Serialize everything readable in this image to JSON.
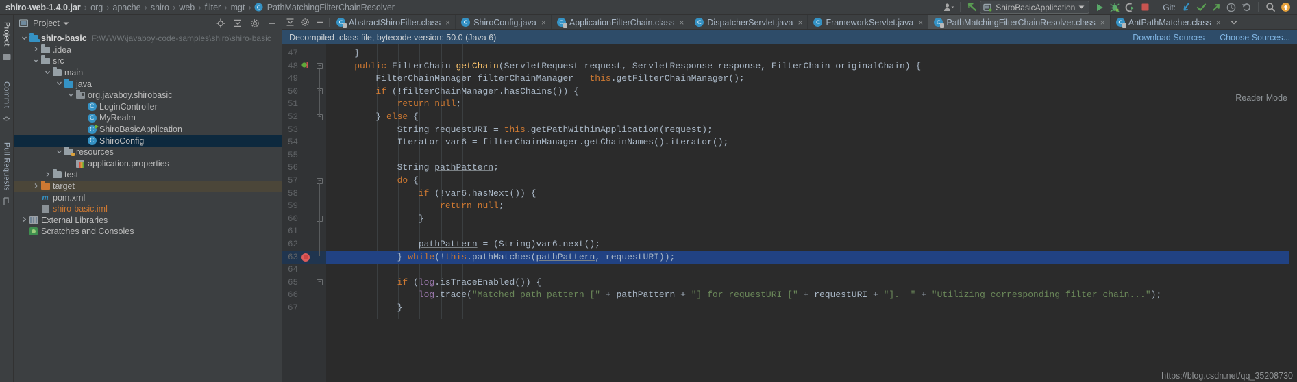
{
  "topbar": {
    "breadcrumbs": [
      "shiro-web-1.4.0.jar",
      "org",
      "apache",
      "shiro",
      "web",
      "filter",
      "mgt",
      "PathMatchingFilterChainResolver"
    ],
    "run_config": "ShiroBasicApplication",
    "git_label": "Git:",
    "icons": [
      "settings-sync-icon",
      "notifications-icon",
      "avatar-icon",
      "updates-icon",
      "run-icon",
      "debug-icon",
      "run-coverage-icon",
      "stop-icon",
      "git-update-icon",
      "git-commit-icon",
      "git-push-icon",
      "git-history-icon",
      "git-rollback-icon",
      "search-everywhere-icon",
      "user-badge-icon"
    ]
  },
  "left_strip": {
    "tabs": [
      "Project",
      "Commit",
      "Pull Requests"
    ]
  },
  "project_panel": {
    "title": "Project",
    "header_icons": [
      "locate-icon",
      "collapse-all-icon",
      "settings-icon",
      "hide-icon"
    ],
    "tree": [
      {
        "label": "shiro-basic",
        "path": "F:\\WWW\\javaboy-code-samples\\shiro\\shiro-basic",
        "indent": 0,
        "arrow": "expanded",
        "icon": "module-folder-icon",
        "state": "bold"
      },
      {
        "label": ".idea",
        "path": "",
        "indent": 1,
        "arrow": "collapsed",
        "icon": "folder-icon",
        "state": ""
      },
      {
        "label": "src",
        "path": "",
        "indent": 1,
        "arrow": "expanded",
        "icon": "folder-icon",
        "state": ""
      },
      {
        "label": "main",
        "path": "",
        "indent": 2,
        "arrow": "expanded",
        "icon": "folder-icon",
        "state": ""
      },
      {
        "label": "java",
        "path": "",
        "indent": 3,
        "arrow": "expanded",
        "icon": "source-folder-icon",
        "state": ""
      },
      {
        "label": "org.javaboy.shirobasic",
        "path": "",
        "indent": 4,
        "arrow": "expanded",
        "icon": "package-icon",
        "state": ""
      },
      {
        "label": "LoginController",
        "path": "",
        "indent": 5,
        "arrow": "none",
        "icon": "class-icon",
        "state": ""
      },
      {
        "label": "MyRealm",
        "path": "",
        "indent": 5,
        "arrow": "none",
        "icon": "class-icon",
        "state": ""
      },
      {
        "label": "ShiroBasicApplication",
        "path": "",
        "indent": 5,
        "arrow": "none",
        "icon": "runnable-class-icon",
        "state": ""
      },
      {
        "label": "ShiroConfig",
        "path": "",
        "indent": 5,
        "arrow": "none",
        "icon": "class-icon",
        "state": "selected"
      },
      {
        "label": "resources",
        "path": "",
        "indent": 3,
        "arrow": "expanded",
        "icon": "resource-folder-icon",
        "state": ""
      },
      {
        "label": "application.properties",
        "path": "",
        "indent": 4,
        "arrow": "none",
        "icon": "properties-icon",
        "state": ""
      },
      {
        "label": "test",
        "path": "",
        "indent": 2,
        "arrow": "collapsed",
        "icon": "folder-icon",
        "state": ""
      },
      {
        "label": "target",
        "path": "",
        "indent": 1,
        "arrow": "collapsed",
        "icon": "excluded-folder-icon",
        "state": "target"
      },
      {
        "label": "pom.xml",
        "path": "",
        "indent": 1,
        "arrow": "none",
        "icon": "maven-icon",
        "state": ""
      },
      {
        "label": "shiro-basic.iml",
        "path": "",
        "indent": 1,
        "arrow": "none",
        "icon": "iml-icon",
        "state": "orange"
      },
      {
        "label": "External Libraries",
        "path": "",
        "indent": 0,
        "arrow": "collapsed",
        "icon": "library-icon",
        "state": ""
      },
      {
        "label": "Scratches and Consoles",
        "path": "",
        "indent": 0,
        "arrow": "none",
        "icon": "scratches-icon",
        "state": ""
      }
    ]
  },
  "editor": {
    "tab_tools": [
      "collapse-icon",
      "settings-icon",
      "hide-icon"
    ],
    "tabs": [
      {
        "label": "AbstractShiroFilter.class",
        "icon": "class-file-icon",
        "active": false
      },
      {
        "label": "ShiroConfig.java",
        "icon": "java-file-icon",
        "active": false
      },
      {
        "label": "ApplicationFilterChain.class",
        "icon": "class-file-icon",
        "active": false
      },
      {
        "label": "DispatcherServlet.java",
        "icon": "java-file-icon",
        "active": false
      },
      {
        "label": "FrameworkServlet.java",
        "icon": "java-file-icon",
        "active": false
      },
      {
        "label": "PathMatchingFilterChainResolver.class",
        "icon": "class-file-icon",
        "active": true
      },
      {
        "label": "AntPathMatcher.class",
        "icon": "class-file-icon",
        "active": false
      }
    ],
    "tab_close_label": "×",
    "tab_overflow_icon": "chevron-down-icon",
    "notice": {
      "text": "Decompiled .class file, bytecode version: 50.0 (Java 6)",
      "download_sources": "Download Sources",
      "choose_sources": "Choose Sources..."
    },
    "reader_mode": "Reader Mode",
    "first_line_number": 47,
    "highlighted_line": 63,
    "breakpoint_line": 63,
    "lines": [
      {
        "n": 47,
        "html": "    }"
      },
      {
        "n": 48,
        "html": "    <span class=\"k\">public</span> FilterChain <span class=\"m\">getChain</span>(ServletRequest request, ServletResponse response, FilterChain originalChain) {"
      },
      {
        "n": 49,
        "html": "        FilterChainManager filterChainManager = <span class=\"k\">this</span>.getFilterChainManager();"
      },
      {
        "n": 50,
        "html": "        <span class=\"k\">if</span> (!filterChainManager.hasChains()) {"
      },
      {
        "n": 51,
        "html": "            <span class=\"k\">return null</span>;"
      },
      {
        "n": 52,
        "html": "        } <span class=\"k\">else</span> {"
      },
      {
        "n": 53,
        "html": "            String requestURI = <span class=\"k\">this</span>.getPathWithinApplication(request);"
      },
      {
        "n": 54,
        "html": "            Iterator var6 = filterChainManager.getChainNames().iterator();"
      },
      {
        "n": 55,
        "html": ""
      },
      {
        "n": 56,
        "html": "            String <span class=\"u\">pathPattern</span>;"
      },
      {
        "n": 57,
        "html": "            <span class=\"k\">do</span> {"
      },
      {
        "n": 58,
        "html": "                <span class=\"k\">if</span> (!var6.hasNext()) {"
      },
      {
        "n": 59,
        "html": "                    <span class=\"k\">return null</span>;"
      },
      {
        "n": 60,
        "html": "                }"
      },
      {
        "n": 61,
        "html": ""
      },
      {
        "n": 62,
        "html": "                <span class=\"u\">pathPattern</span> = (String)var6.next();"
      },
      {
        "n": 63,
        "html": "            } <span class=\"k\">while</span>(!<span class=\"k\">this</span>.pathMatches(<span class=\"u\">pathPattern</span>, requestURI));"
      },
      {
        "n": 64,
        "html": ""
      },
      {
        "n": 65,
        "html": "            <span class=\"k\">if</span> (<span class=\"f\">log</span>.isTraceEnabled()) {"
      },
      {
        "n": 66,
        "html": "                <span class=\"f\">log</span>.trace(<span class=\"s\">\"Matched path pattern [\"</span> + <span class=\"u\">pathPattern</span> + <span class=\"s\">\"] for requestURI [\"</span> + requestURI + <span class=\"s\">\"].  \"</span> + <span class=\"s\">\"Utilizing corresponding filter chain...\"</span>);"
      },
      {
        "n": 67,
        "html": "            }"
      }
    ]
  },
  "watermark": "https://blog.csdn.net/qq_35208730"
}
